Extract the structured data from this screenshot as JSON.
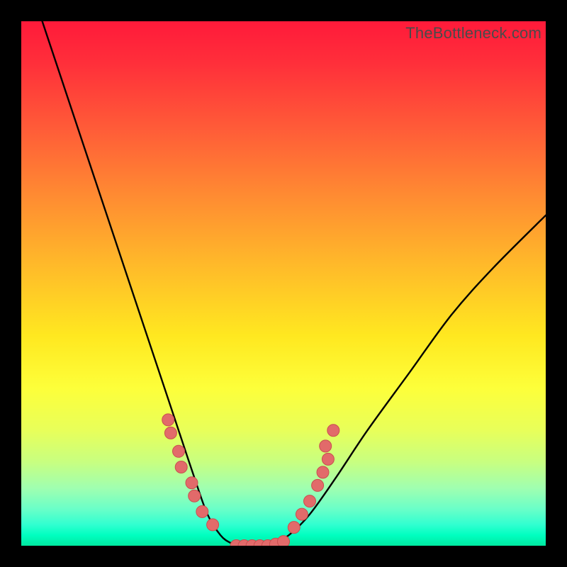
{
  "watermark": "TheBottleneck.com",
  "chart_data": {
    "type": "line",
    "title": "",
    "xlabel": "",
    "ylabel": "",
    "xlim": [
      0,
      100
    ],
    "ylim": [
      0,
      100
    ],
    "grid": false,
    "legend": false,
    "series": [
      {
        "name": "bottleneck-curve",
        "x": [
          4,
          8,
          12,
          16,
          20,
          24,
          28,
          30,
          33,
          35.5,
          38,
          40,
          42,
          44,
          46,
          48,
          51,
          55,
          60,
          66,
          74,
          82,
          90,
          100
        ],
        "y": [
          100,
          88,
          76,
          64,
          52,
          40,
          28,
          22,
          13,
          6,
          2,
          0.5,
          0,
          0,
          0,
          0.5,
          2,
          6,
          13,
          22,
          33,
          44,
          53,
          63
        ]
      }
    ],
    "marker_clusters": [
      {
        "name": "left-cluster",
        "points": [
          {
            "x": 28.0,
            "y": 24.0
          },
          {
            "x": 28.5,
            "y": 21.5
          },
          {
            "x": 30.0,
            "y": 18.0
          },
          {
            "x": 30.5,
            "y": 15.0
          },
          {
            "x": 32.5,
            "y": 12.0
          },
          {
            "x": 33.0,
            "y": 9.5
          },
          {
            "x": 34.5,
            "y": 6.5
          },
          {
            "x": 36.5,
            "y": 4.0
          }
        ]
      },
      {
        "name": "bottom-cluster",
        "points": [
          {
            "x": 41.0,
            "y": 0.0
          },
          {
            "x": 42.5,
            "y": 0.0
          },
          {
            "x": 44.0,
            "y": 0.0
          },
          {
            "x": 45.5,
            "y": 0.0
          },
          {
            "x": 47.0,
            "y": 0.0
          },
          {
            "x": 48.5,
            "y": 0.3
          },
          {
            "x": 50.0,
            "y": 0.8
          }
        ]
      },
      {
        "name": "right-cluster",
        "points": [
          {
            "x": 52.0,
            "y": 3.5
          },
          {
            "x": 53.5,
            "y": 6.0
          },
          {
            "x": 55.0,
            "y": 8.5
          },
          {
            "x": 56.5,
            "y": 11.5
          },
          {
            "x": 57.5,
            "y": 14.0
          },
          {
            "x": 58.5,
            "y": 16.5
          },
          {
            "x": 58.0,
            "y": 19.0
          },
          {
            "x": 59.5,
            "y": 22.0
          }
        ]
      }
    ],
    "colors": {
      "curve": "#000000",
      "marker_fill": "#e26a6a",
      "marker_stroke": "#c94f4f"
    }
  }
}
